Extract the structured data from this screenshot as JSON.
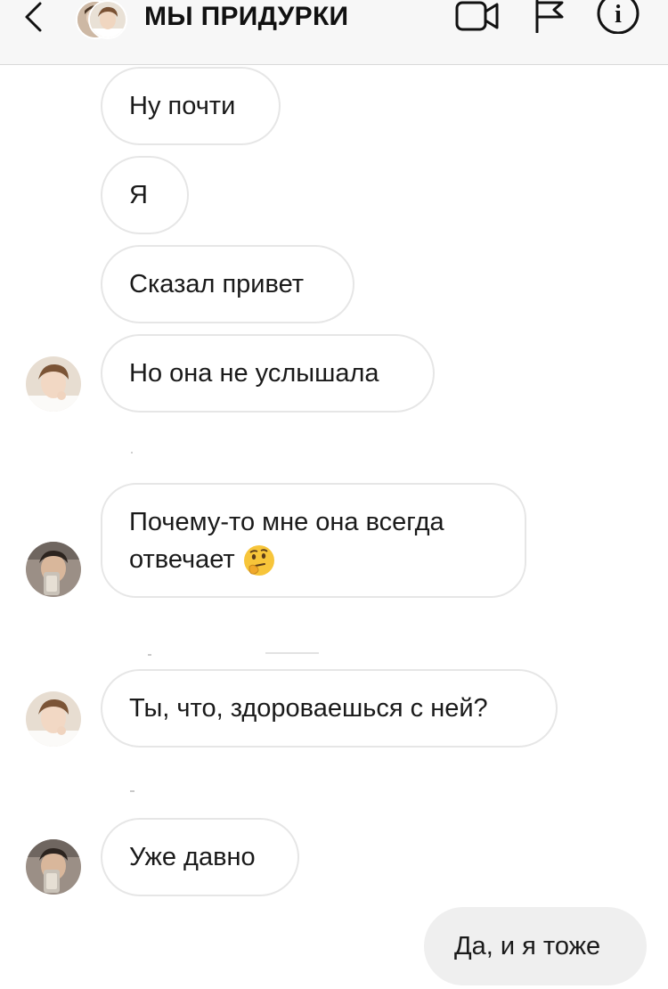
{
  "header": {
    "title": "МЫ ПРИДУРКИ",
    "back_icon": "chevron-left-icon",
    "video_icon": "video-camera-icon",
    "flag_icon": "flag-icon",
    "info_icon": "info-icon",
    "info_glyph": "i"
  },
  "messages": [
    {
      "id": "m1",
      "text": "Ну почти",
      "direction": "incoming"
    },
    {
      "id": "m2",
      "text": "Я",
      "direction": "incoming"
    },
    {
      "id": "m3",
      "text": "Сказал привет",
      "direction": "incoming"
    },
    {
      "id": "m4",
      "text": "Но она не услышала",
      "direction": "incoming",
      "avatar": "avatar-1"
    },
    {
      "id": "m5",
      "text_line1": "Почему-то мне она всегда",
      "text_line2": "отвечает",
      "emoji": "thinking-face-emoji",
      "direction": "incoming",
      "avatar": "avatar-2"
    },
    {
      "id": "m6",
      "text": "Ты, что, здороваешься с ней?",
      "direction": "incoming",
      "avatar": "avatar-1"
    },
    {
      "id": "m7",
      "text": "Уже давно",
      "direction": "incoming",
      "avatar": "avatar-2"
    },
    {
      "id": "m8",
      "text": "Да, и я тоже",
      "direction": "outgoing"
    }
  ],
  "colors": {
    "header_bg": "#f7f7f7",
    "incoming_border": "#e6e6e6",
    "outgoing_bg": "#efefef",
    "text": "#1a1a1a"
  }
}
